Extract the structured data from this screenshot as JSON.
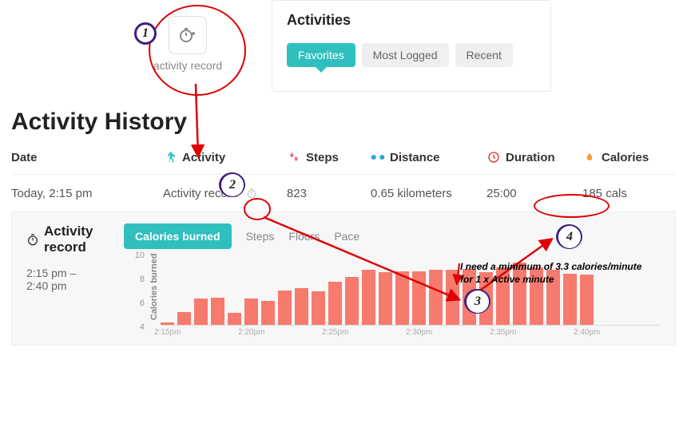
{
  "top": {
    "activity_record_label": "activity record",
    "activities_title": "Activities",
    "tabs": {
      "favorites": "Favorites",
      "most_logged": "Most Logged",
      "recent": "Recent"
    }
  },
  "page_title": "Activity History",
  "columns": {
    "date": "Date",
    "activity": "Activity",
    "steps": "Steps",
    "distance": "Distance",
    "duration": "Duration",
    "calories": "Calories"
  },
  "row": {
    "date": "Today, 2:15 pm",
    "activity": "Activity record",
    "steps": "823",
    "distance": "0.65 kilometers",
    "duration": "25:00",
    "calories": "185 cals"
  },
  "detail": {
    "title": "Activity record",
    "timerange": "2:15 pm – 2:40 pm",
    "tabs": {
      "calories_burned": "Calories burned",
      "steps": "Steps",
      "floors": "Floors",
      "pace": "Pace"
    },
    "y_title": "Calories burned"
  },
  "chart_data": {
    "type": "bar",
    "title": "Calories burned",
    "xlabel": "",
    "ylabel": "Calories burned",
    "ylim": [
      4,
      10
    ],
    "y_ticks": [
      4,
      6,
      8,
      10
    ],
    "x_tick_labels": [
      "2:15pm",
      "2:20pm",
      "2:25pm",
      "2:30pm",
      "2:35pm",
      "2:40pm"
    ],
    "values": [
      4.2,
      5.1,
      6.2,
      6.3,
      5.0,
      6.2,
      6.0,
      6.9,
      7.1,
      6.8,
      7.6,
      8.0,
      8.6,
      8.4,
      8.5,
      8.5,
      8.6,
      8.6,
      8.7,
      8.4,
      8.8,
      9.2,
      8.8,
      8.6,
      8.3,
      8.2
    ]
  },
  "annotations": {
    "badge1": "1",
    "badge2": "2",
    "badge3": "3",
    "badge4": "4",
    "note_line1": "I need a minimum of 3.3 calories/minute",
    "note_line2": "for 1 x Active minute"
  },
  "colors": {
    "teal": "#30bfbf",
    "bar": "#f77a6f",
    "purple": "#3e1f82",
    "red": "#de0000"
  }
}
